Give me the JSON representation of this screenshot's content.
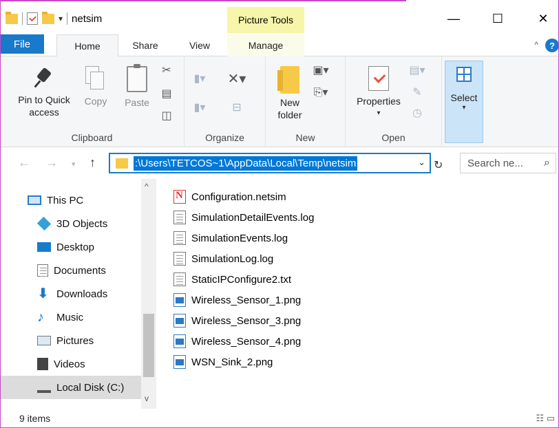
{
  "titlebar": {
    "title": "netsim",
    "context_tab_group": "Picture Tools",
    "minimize": "—",
    "maximize": "☐",
    "close": "✕"
  },
  "tabs": {
    "file": "File",
    "home": "Home",
    "share": "Share",
    "view": "View",
    "manage": "Manage",
    "help": "?"
  },
  "ribbon": {
    "clipboard": {
      "label": "Clipboard",
      "pin_label": "Pin to Quick access",
      "copy_label": "Copy",
      "paste_label": "Paste"
    },
    "organize": {
      "label": "Organize"
    },
    "new": {
      "label": "New",
      "new_folder_label": "New folder"
    },
    "open": {
      "label": "Open",
      "properties_label": "Properties"
    },
    "select": {
      "select_label": "Select"
    }
  },
  "address": {
    "path": ":\\Users\\TETCOS~1\\AppData\\Local\\Temp\\netsim",
    "search_placeholder": "Search ne..."
  },
  "navpane": {
    "items": [
      {
        "label": "This PC",
        "icon": "pc-icon"
      },
      {
        "label": "3D Objects",
        "icon": "cube-icon"
      },
      {
        "label": "Desktop",
        "icon": "desktop-icon"
      },
      {
        "label": "Documents",
        "icon": "documents-icon"
      },
      {
        "label": "Downloads",
        "icon": "download-icon"
      },
      {
        "label": "Music",
        "icon": "music-icon"
      },
      {
        "label": "Pictures",
        "icon": "pictures-icon"
      },
      {
        "label": "Videos",
        "icon": "videos-icon"
      },
      {
        "label": "Local Disk (C:)",
        "icon": "disk-icon"
      }
    ]
  },
  "files": [
    {
      "name": "Configuration.netsim",
      "type": "netsim"
    },
    {
      "name": "SimulationDetailEvents.log",
      "type": "doc"
    },
    {
      "name": "SimulationEvents.log",
      "type": "doc"
    },
    {
      "name": "SimulationLog.log",
      "type": "doc"
    },
    {
      "name": "StaticIPConfigure2.txt",
      "type": "doc"
    },
    {
      "name": "Wireless_Sensor_1.png",
      "type": "png"
    },
    {
      "name": "Wireless_Sensor_3.png",
      "type": "png"
    },
    {
      "name": "Wireless_Sensor_4.png",
      "type": "png"
    },
    {
      "name": "WSN_Sink_2.png",
      "type": "png"
    }
  ],
  "status": {
    "item_count": "9 items"
  },
  "colors": {
    "accent": "#1979ca",
    "context_tab": "#f7f5a9",
    "selection": "#0078d7"
  }
}
